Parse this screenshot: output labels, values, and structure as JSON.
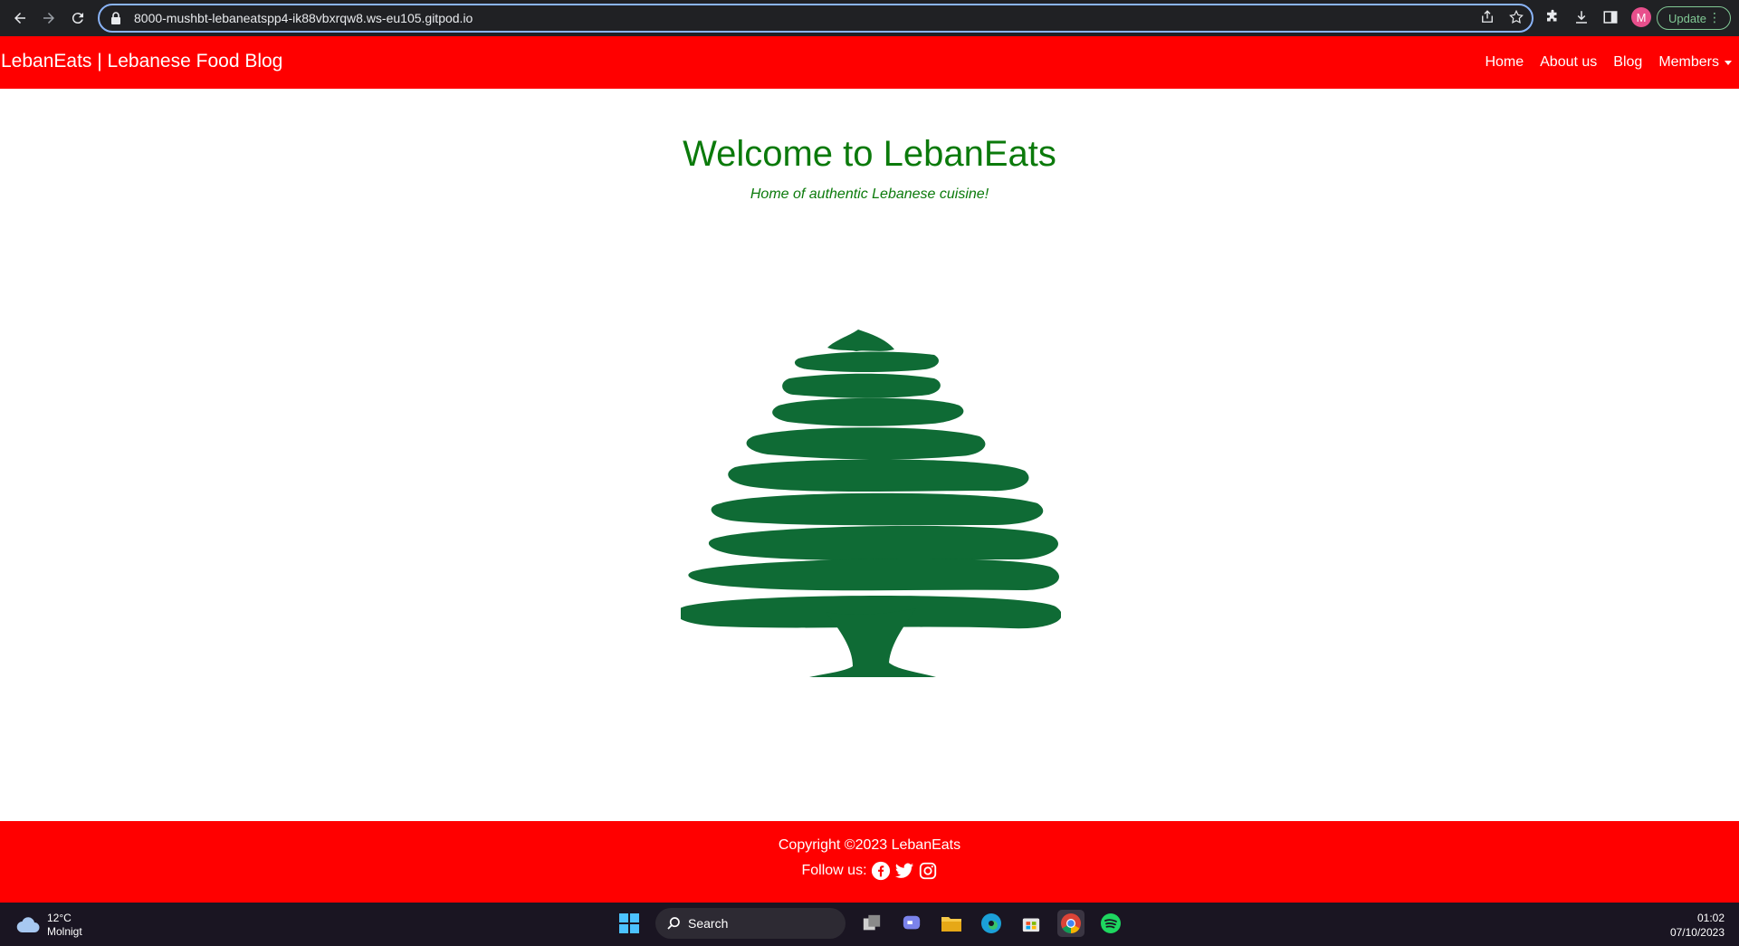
{
  "browser": {
    "url": "8000-mushbt-lebaneatspp4-ik88vbxrqw8.ws-eu105.gitpod.io",
    "profile_initial": "M",
    "update_label": "Update"
  },
  "navbar": {
    "brand": "LebanEats | Lebanese Food Blog",
    "links": [
      "Home",
      "About us",
      "Blog",
      "Members"
    ]
  },
  "hero": {
    "title": "Welcome to LebanEats",
    "tagline": "Home of authentic Lebanese cuisine!",
    "image_icon": "cedar-tree-icon"
  },
  "footer": {
    "copyright": "Copyright ©2023 LebanEats",
    "follow_label": "Follow us:",
    "social_icons": [
      "facebook-icon",
      "twitter-icon",
      "instagram-icon"
    ]
  },
  "taskbar": {
    "weather_temp": "12°C",
    "weather_desc": "Molnigt",
    "search_label": "Search",
    "time": "01:02",
    "date": "07/10/2023"
  },
  "colors": {
    "brand_red": "#ff0000",
    "heading_green": "#0b7a0b",
    "cedar_green": "#0f6b35"
  }
}
